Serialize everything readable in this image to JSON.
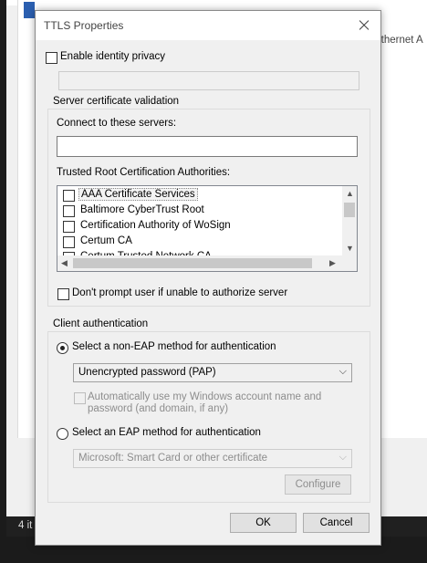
{
  "background": {
    "adapter_text": "Ethernet A",
    "status_text": "4 it"
  },
  "dialog": {
    "title": "TTLS Properties",
    "enable_identity_privacy": {
      "label": "Enable identity privacy",
      "checked": false
    },
    "identity_value": "",
    "server_validation": {
      "group_title": "Server certificate validation",
      "connect_label": "Connect to these servers:",
      "connect_value": "",
      "authorities_label": "Trusted Root Certification Authorities:",
      "authorities": [
        {
          "label": "AAA Certificate Services",
          "checked": false
        },
        {
          "label": "Baltimore CyberTrust Root",
          "checked": false
        },
        {
          "label": "Certification Authority of WoSign",
          "checked": false
        },
        {
          "label": "Certum CA",
          "checked": false
        },
        {
          "label": "Certum Trusted Network CA",
          "checked": false
        }
      ],
      "dont_prompt_label": "Don't prompt user if unable to authorize server"
    },
    "client_auth": {
      "group_title": "Client authentication",
      "non_eap_label": "Select a non-EAP method for authentication",
      "non_eap_selected": true,
      "non_eap_method": "Unencrypted password (PAP)",
      "auto_windows_line1": "Automatically use my Windows account name and",
      "auto_windows_line2": "password (and domain, if any)",
      "eap_label": "Select an EAP method for authentication",
      "eap_method": "Microsoft: Smart Card or other certificate",
      "configure_label": "Configure"
    },
    "ok_label": "OK",
    "cancel_label": "Cancel"
  }
}
